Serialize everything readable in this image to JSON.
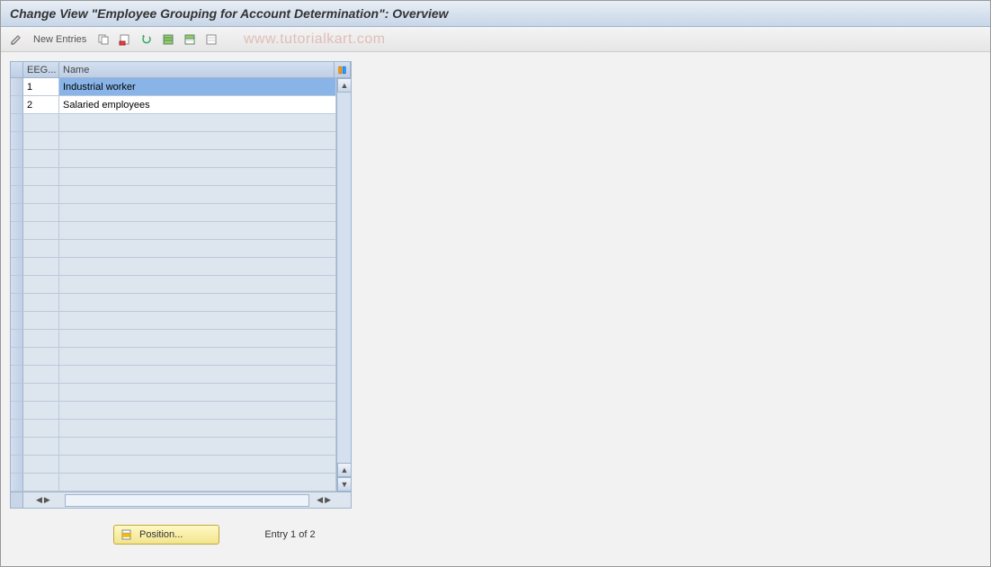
{
  "header": {
    "title": "Change View \"Employee Grouping for Account Determination\": Overview"
  },
  "toolbar": {
    "new_entries_label": "New Entries",
    "watermark": "www.tutorialkart.com"
  },
  "table": {
    "columns": {
      "eeg_header": "EEG...",
      "name_header": "Name"
    },
    "rows": [
      {
        "eeg": "1",
        "name": "Industrial worker",
        "selected": true
      },
      {
        "eeg": "2",
        "name": "Salaried employees",
        "selected": false
      }
    ],
    "empty_rows": 21
  },
  "footer": {
    "position_button_label": "Position...",
    "entry_text": "Entry 1 of 2"
  }
}
